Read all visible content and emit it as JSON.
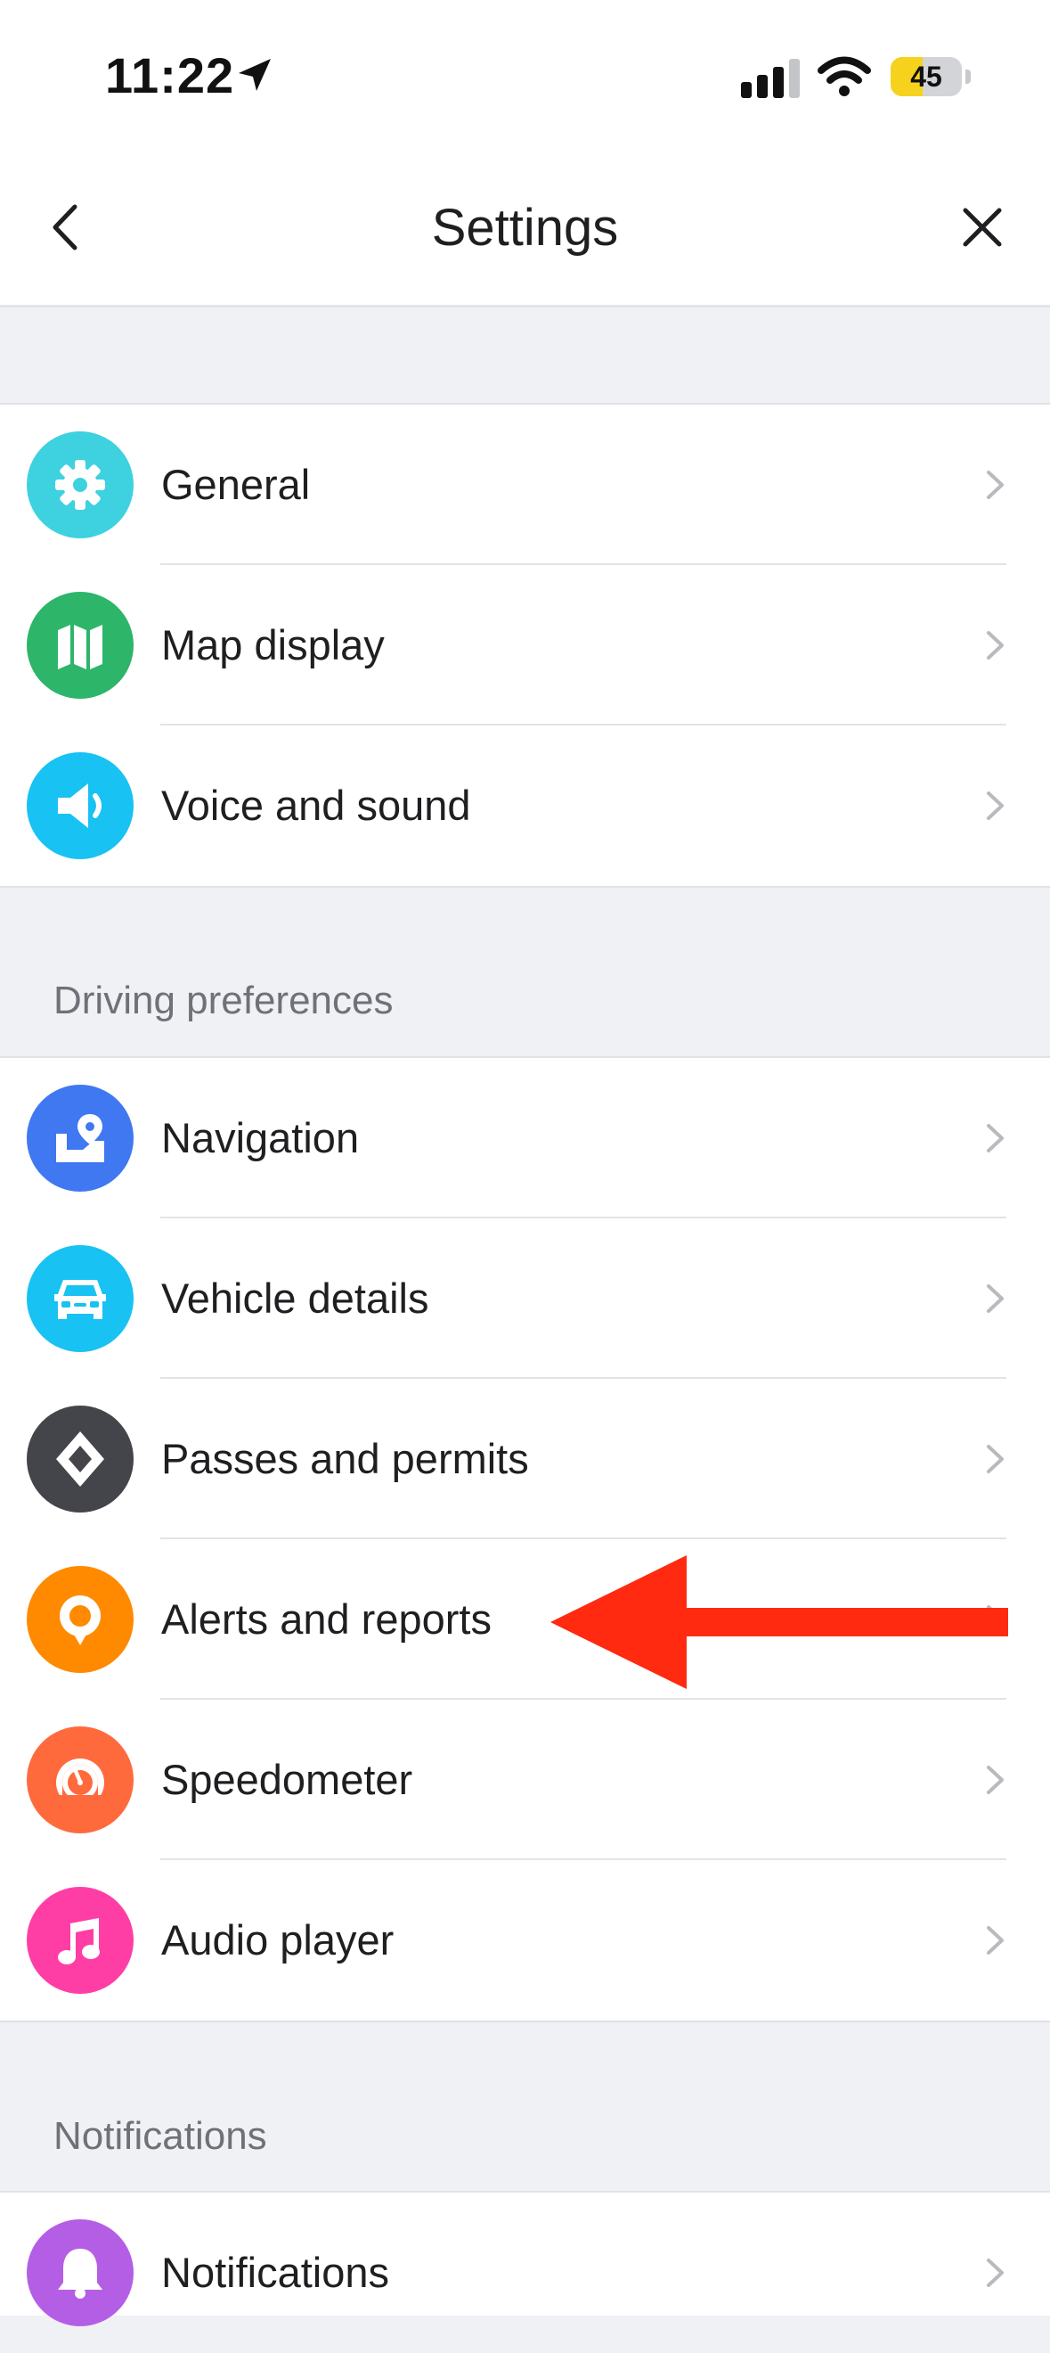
{
  "status_bar": {
    "time": "11:22",
    "battery_level": "45",
    "battery_fraction": 0.45,
    "battery_color": "#f7d21c"
  },
  "nav": {
    "title": "Settings",
    "back_icon": "chevron-left-icon",
    "close_icon": "close-icon"
  },
  "groups": {
    "general": {
      "items": [
        {
          "label": "General",
          "icon": "gear-icon",
          "color": "#3ed1e0"
        },
        {
          "label": "Map display",
          "icon": "map-icon",
          "color": "#2db56a"
        },
        {
          "label": "Voice and sound",
          "icon": "speaker-icon",
          "color": "#18c2f2"
        }
      ]
    },
    "driving": {
      "header": "Driving preferences",
      "items": [
        {
          "label": "Navigation",
          "icon": "map-pin-icon",
          "color": "#3f78f0"
        },
        {
          "label": "Vehicle details",
          "icon": "car-icon",
          "color": "#18c2f2"
        },
        {
          "label": "Passes and permits",
          "icon": "diamond-icon",
          "color": "#44454a"
        },
        {
          "label": "Alerts and reports",
          "icon": "alert-pin-icon",
          "color": "#ff8a00"
        },
        {
          "label": "Speedometer",
          "icon": "speedometer-icon",
          "color": "#ff6a3d"
        },
        {
          "label": "Audio player",
          "icon": "music-note-icon",
          "color": "#ff3ea5"
        }
      ]
    },
    "notifications": {
      "header": "Notifications",
      "items": [
        {
          "label": "Notifications",
          "icon": "bell-icon",
          "color": "#b45ee6"
        }
      ]
    }
  },
  "annotation": {
    "arrow_color": "#ff2a10",
    "points_to": "Alerts and reports"
  }
}
